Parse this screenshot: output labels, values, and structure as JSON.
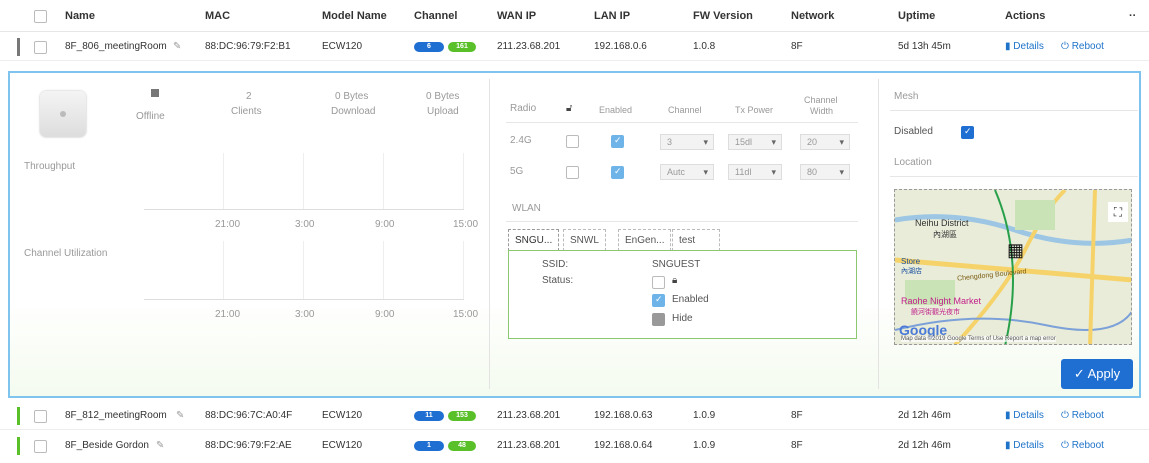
{
  "headers": {
    "name": "Name",
    "mac": "MAC",
    "model": "Model Name",
    "channel": "Channel",
    "wan": "WAN IP",
    "lan": "LAN IP",
    "fw": "FW Version",
    "network": "Network",
    "uptime": "Uptime",
    "actions": "Actions",
    "more": "··"
  },
  "devices": [
    {
      "name": "8F_806_meetingRoom",
      "mac": "88:DC:96:79:F2:B1",
      "model": "ECW120",
      "ch1": "6",
      "ch2": "161",
      "wan": "211.23.68.201",
      "lan": "192.168.0.6",
      "fw": "1.0.8",
      "network": "8F",
      "uptime": "5d 13h 45m",
      "status_color": "#777777"
    },
    {
      "name": "8F_812_meetingRoom",
      "mac": "88:DC:96:7C:A0:4F",
      "model": "ECW120",
      "ch1": "11",
      "ch2": "153",
      "wan": "211.23.68.201",
      "lan": "192.168.0.63",
      "fw": "1.0.9",
      "network": "8F",
      "uptime": "2d 12h 46m",
      "status_color": "#5ac02a"
    },
    {
      "name": "8F_Beside Gordon",
      "mac": "88:DC:96:79:F2:AE",
      "model": "ECW120",
      "ch1": "1",
      "ch2": "48",
      "wan": "211.23.68.201",
      "lan": "192.168.0.64",
      "fw": "1.0.9",
      "network": "8F",
      "uptime": "2d 12h 46m",
      "status_color": "#5ac02a"
    }
  ],
  "actions": {
    "details": "Details",
    "reboot": "Reboot"
  },
  "detail": {
    "status": "Offline",
    "clients_val": "2",
    "clients_label": "Clients",
    "download_val": "0 Bytes",
    "download_label": "Download",
    "upload_val": "0 Bytes",
    "upload_label": "Upload",
    "throughput": "Throughput",
    "channel_util": "Channel Utilization",
    "time_ticks": [
      "21:00",
      "3:00",
      "9:00",
      "15:00"
    ],
    "radio": {
      "headers": {
        "radio": "Radio",
        "enabled": "Enabled",
        "channel": "Channel",
        "txpower": "Tx Power",
        "width_1": "Channel",
        "width_2": "Width"
      },
      "rows": [
        {
          "band": "2.4G",
          "channel": "3",
          "txpower": "15dl",
          "width": "20"
        },
        {
          "band": "5G",
          "channel": "Autc",
          "txpower": "11dl",
          "width": "80"
        }
      ]
    },
    "wlan": {
      "title": "WLAN",
      "tabs": [
        "SNGU...",
        "SNWL",
        "EnGen...",
        "test"
      ],
      "ssid_label": "SSID:",
      "ssid_value": "SNGUEST",
      "status_label": "Status:",
      "enabled_label": "Enabled",
      "hide_label": "Hide"
    },
    "mesh": {
      "title": "Mesh",
      "disabled_label": "Disabled"
    },
    "location": {
      "title": "Location",
      "map_labels": {
        "district": "Neihu District",
        "district_zh": "內湖區",
        "store": "Store",
        "store_zh": "內湖店",
        "boulevard": "Chengdong Boulevard",
        "night_market": "Raohe Night Market",
        "night_market_zh": "饒河街觀光夜市",
        "footer": "Map data ©2019 Google   Terms of Use   Report a map error",
        "google": "Google"
      }
    },
    "apply_label": "Apply"
  }
}
